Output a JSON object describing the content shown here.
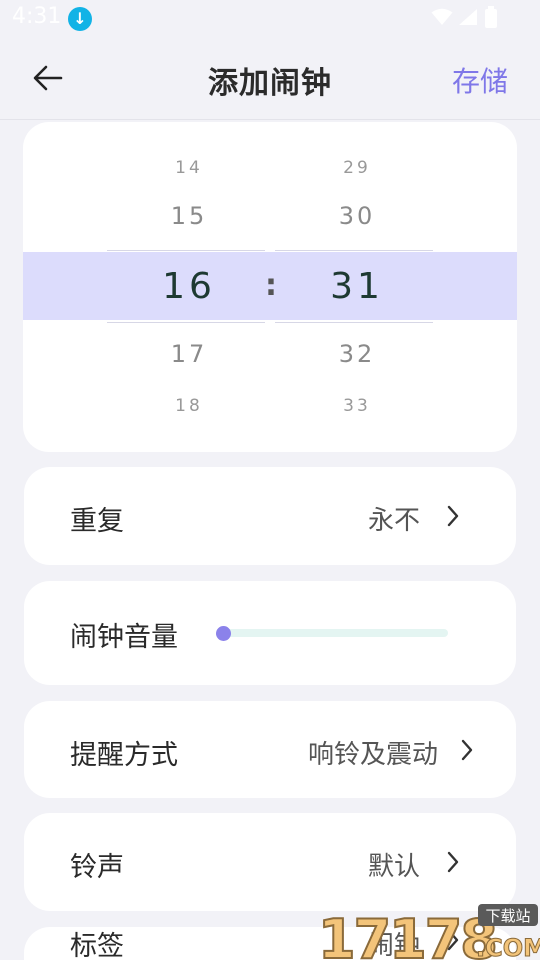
{
  "status_bar": {
    "time": "4:31",
    "download_icon": "download-arrow-icon",
    "wifi_icon": "wifi-icon",
    "signal_icon": "signal-icon",
    "battery_icon": "battery-icon"
  },
  "header": {
    "back_icon": "back-arrow-icon",
    "title": "添加闹钟",
    "save_label": "存储",
    "accent_color": "#7f77e8"
  },
  "time_picker": {
    "hours": [
      "14",
      "15",
      "16",
      "17",
      "18"
    ],
    "minutes": [
      "29",
      "30",
      "31",
      "32",
      "33"
    ],
    "selected_hour": "16",
    "selected_minute": "31",
    "separator": ":",
    "highlight_color": "#dcdcfc"
  },
  "settings": {
    "repeat": {
      "label": "重复",
      "value": "永不"
    },
    "volume": {
      "label": "闹钟音量",
      "level": 0
    },
    "reminder_mode": {
      "label": "提醒方式",
      "value": "响铃及震动"
    },
    "ringtone": {
      "label": "铃声",
      "value": "默认"
    },
    "tag": {
      "label": "标签",
      "value": "闹钟"
    }
  },
  "watermark": {
    "text": "17178",
    "suffix": ".COM",
    "badge": "下载站"
  }
}
